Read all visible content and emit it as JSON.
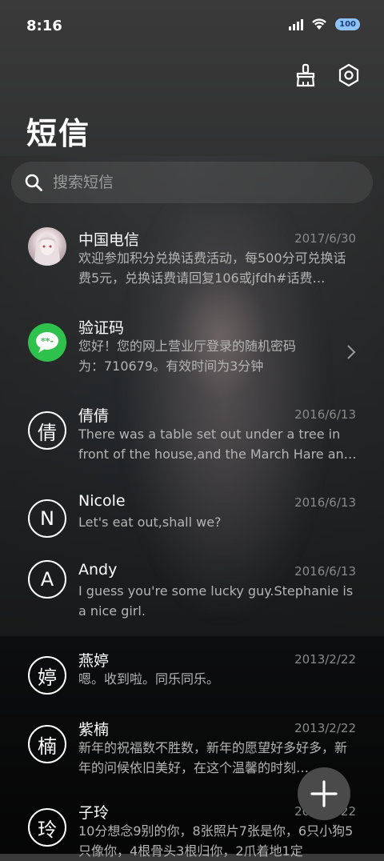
{
  "status": {
    "time": "8:16",
    "battery": "100"
  },
  "header": {
    "title": "短信"
  },
  "icons": {
    "clean": "broom-icon",
    "settings": "hexagon-settings-icon",
    "search": "search-icon",
    "add": "plus-icon"
  },
  "search": {
    "placeholder": "搜索短信"
  },
  "messages": [
    {
      "name": "中国电信",
      "date": "2017/6/30",
      "preview": "欢迎参加积分兑换话费活动，每500分可兑换话费5元，兑换话费请回复106或jfdh#话费…",
      "avatar": "image"
    },
    {
      "name": "验证码",
      "date": "",
      "preview": "您好！您的网上营业厅登录的随机密码为：710679。有效时间为3分钟",
      "avatar": "chat-bubble"
    },
    {
      "name": "倩倩",
      "date": "2016/6/13",
      "preview": "There was a table set out under a tree in front of the house,and the March Hare an…",
      "avatar": "倩"
    },
    {
      "name": "Nicole",
      "date": "2016/6/13",
      "preview": "Let's eat out,shall we?",
      "avatar": "N"
    },
    {
      "name": "Andy",
      "date": "2016/6/13",
      "preview": "I guess you're some lucky guy.Stephanie is a nice girl.",
      "avatar": "A"
    },
    {
      "name": "燕婷",
      "date": "2013/2/22",
      "preview": "嗯。收到啦。同乐同乐。",
      "avatar": "婷"
    },
    {
      "name": "紫楠",
      "date": "2013/2/22",
      "preview": "新年的祝福数不胜数，新年的愿望好多好多，新年的问候依旧美好，在这个温馨的时刻…",
      "avatar": "楠"
    },
    {
      "name": "子玲",
      "date": "2013/2/22",
      "preview": "10分想念9别的你，8张照片7张是你，6只小狗5只像你，4根骨头3根归你，2爪着地1定",
      "avatar": "玲"
    }
  ]
}
